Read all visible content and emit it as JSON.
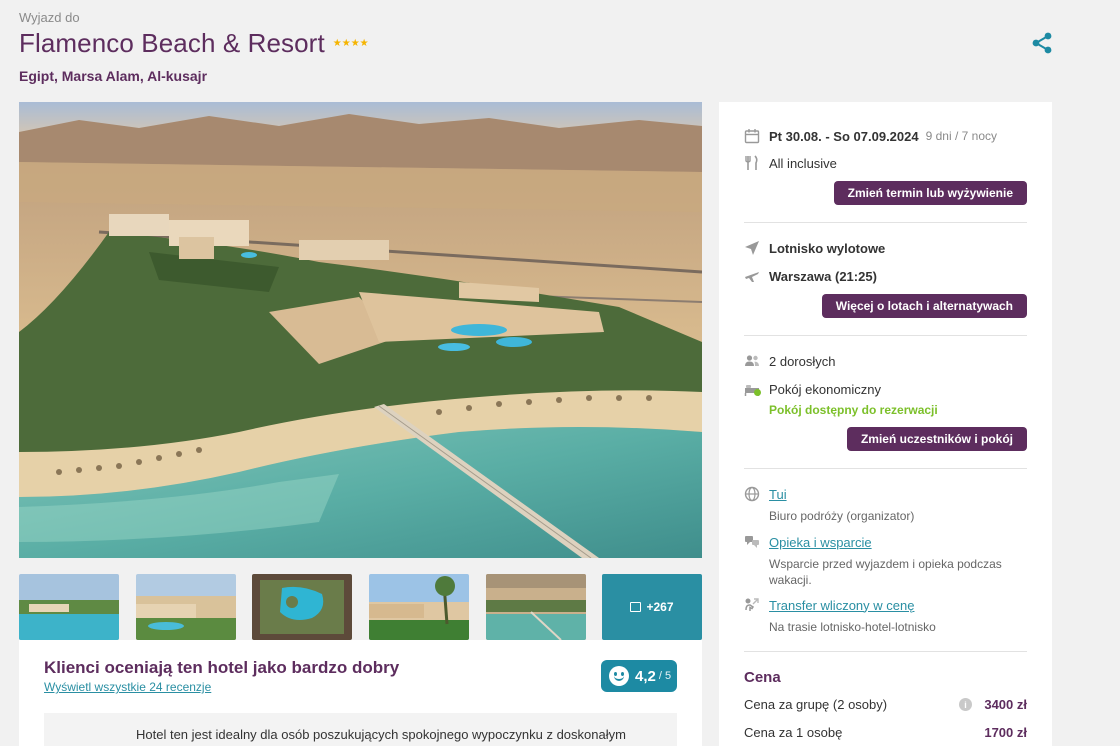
{
  "header": {
    "pre_title": "Wyjazd do",
    "title": "Flamenco Beach & Resort",
    "stars": "★★★★",
    "location": "Egipt, Marsa Alam, Al-kusajr",
    "share_icon": "share-icon"
  },
  "gallery": {
    "more_label": "+267",
    "thumbnails": [
      "thumb-1",
      "thumb-2",
      "thumb-3",
      "thumb-4",
      "thumb-5"
    ]
  },
  "reviews": {
    "title": "Klienci oceniają ten hotel jako bardzo dobry",
    "link": "Wyświetl wszystkie 24 recenzje",
    "rating": "4,2",
    "rating_max": "/ 5",
    "summary": "Hotel ten jest idealny dla osób poszukujących spokojnego wypoczynku z doskonałym"
  },
  "booking": {
    "dates": "Pt 30.08. - So 07.09.2024",
    "duration": "9 dni / 7 nocy",
    "board": "All inclusive",
    "change_term_button": "Zmień termin lub wyżywienie",
    "airport_label": "Lotnisko wylotowe",
    "airport_value": "Warszawa (21:25)",
    "flights_button": "Więcej o lotach i alternatywach",
    "travellers": "2 dorosłych",
    "room": "Pokój ekonomiczny",
    "room_status": "Pokój dostępny do rezerwacji",
    "change_participants_button": "Zmień uczestników i pokój",
    "organizer_link": "Tui",
    "organizer_sub": "Biuro podróży (organizator)",
    "care_link": "Opieka i wsparcie",
    "care_sub_1": "Wsparcie przed wyjazdem i opieka podczas",
    "care_sub_2": "wakacji.",
    "transfer_link": "Transfer wliczony w cenę",
    "transfer_sub": "Na trasie lotnisko-hotel-lotnisko"
  },
  "price": {
    "heading": "Cena",
    "group_label": "Cena za grupę (2 osoby)",
    "group_value": "3400 zł",
    "person_label": "Cena za 1 osobę",
    "person_value": "1700 zł",
    "info_icon": "info-icon"
  },
  "colors": {
    "brand": "#5d2d5e",
    "accent": "#1d8aa3",
    "green": "#7cc02a",
    "star": "#f5b400"
  }
}
